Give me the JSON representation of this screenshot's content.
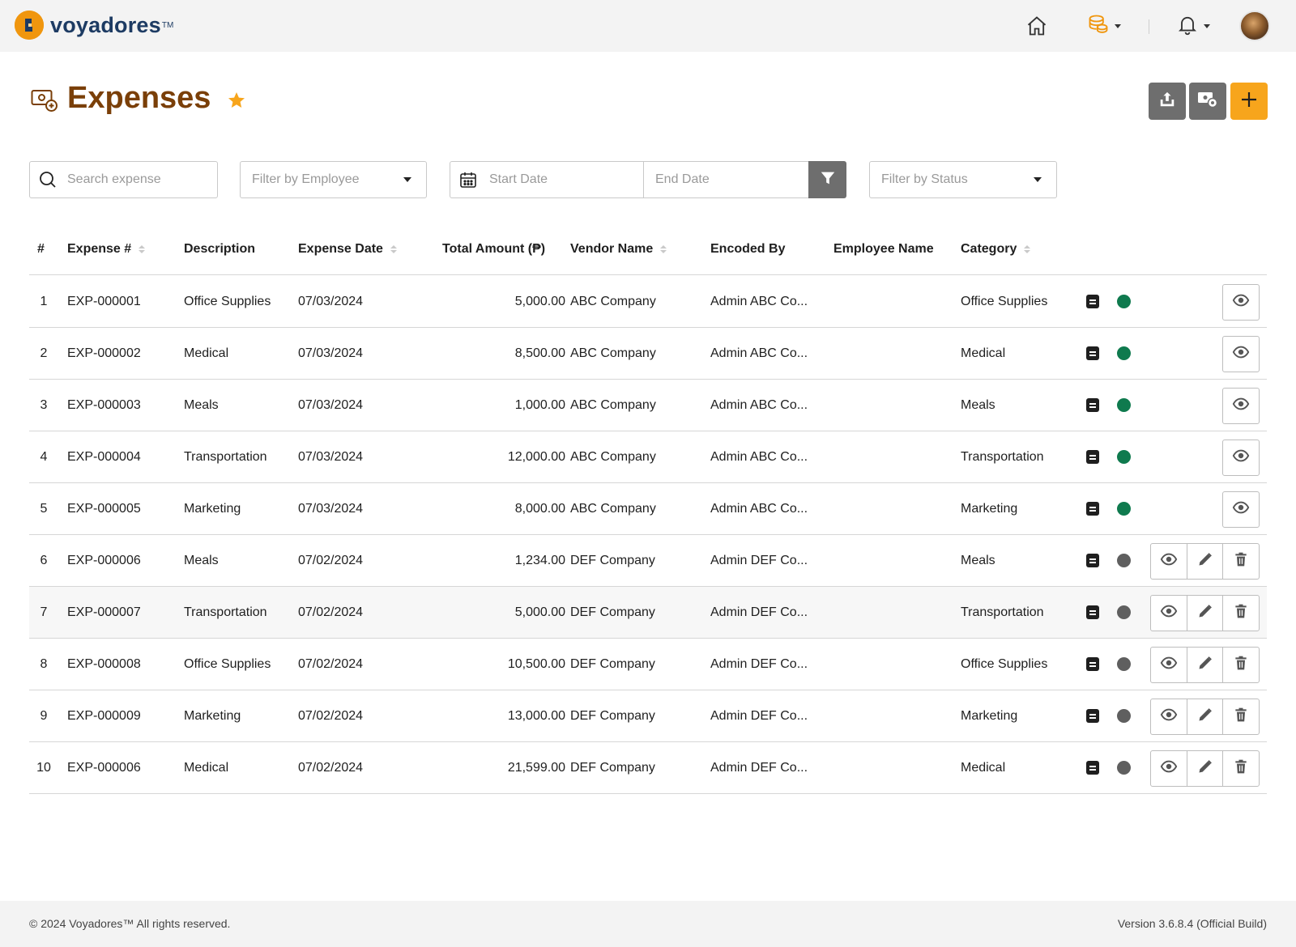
{
  "brand": {
    "name": "voyadores",
    "tm": "TM",
    "accent": "#f7a51c",
    "title_color": "#7a3f08"
  },
  "topbar": {
    "icons": [
      "home-icon",
      "coins-icon",
      "bell-icon"
    ],
    "avatar": "user-avatar"
  },
  "header": {
    "title": "Expenses",
    "icon": "money-icon",
    "favorite": "star-icon"
  },
  "toolbar": {
    "buttons": [
      "upload-icon",
      "expense-settings-icon",
      "plus-icon"
    ]
  },
  "filters": {
    "search_placeholder": "Search expense",
    "employee_placeholder": "Filter by Employee",
    "start_date_placeholder": "Start Date",
    "end_date_placeholder": "End Date",
    "status_placeholder": "Filter by Status"
  },
  "table": {
    "columns": {
      "num": "#",
      "expense_no": "Expense #",
      "description": "Description",
      "expense_date": "Expense Date",
      "total_amount": "Total Amount (₱)",
      "vendor": "Vendor Name",
      "encoded_by": "Encoded By",
      "employee": "Employee Name",
      "category": "Category"
    },
    "status_colors": {
      "approved": "#0f7a4e",
      "pending": "#5f5f5f"
    },
    "rows": [
      {
        "num": "1",
        "expense_no": "EXP-000001",
        "description": "Office Supplies",
        "date": "07/03/2024",
        "amount": "5,000.00",
        "vendor": "ABC Company",
        "encoded_by": "Admin ABC Co...",
        "employee": "",
        "category": "Office Supplies",
        "status": "approved"
      },
      {
        "num": "2",
        "expense_no": "EXP-000002",
        "description": "Medical",
        "date": "07/03/2024",
        "amount": "8,500.00",
        "vendor": "ABC Company",
        "encoded_by": "Admin ABC Co...",
        "employee": "",
        "category": "Medical",
        "status": "approved"
      },
      {
        "num": "3",
        "expense_no": "EXP-000003",
        "description": "Meals",
        "date": "07/03/2024",
        "amount": "1,000.00",
        "vendor": "ABC Company",
        "encoded_by": "Admin ABC Co...",
        "employee": "",
        "category": "Meals",
        "status": "approved"
      },
      {
        "num": "4",
        "expense_no": "EXP-000004",
        "description": "Transportation",
        "date": "07/03/2024",
        "amount": "12,000.00",
        "vendor": "ABC Company",
        "encoded_by": "Admin ABC Co...",
        "employee": "",
        "category": "Transportation",
        "status": "approved"
      },
      {
        "num": "5",
        "expense_no": "EXP-000005",
        "description": "Marketing",
        "date": "07/03/2024",
        "amount": "8,000.00",
        "vendor": "ABC Company",
        "encoded_by": "Admin ABC Co...",
        "employee": "",
        "category": "Marketing",
        "status": "approved"
      },
      {
        "num": "6",
        "expense_no": "EXP-000006",
        "description": "Meals",
        "date": "07/02/2024",
        "amount": "1,234.00",
        "vendor": "DEF Company",
        "encoded_by": "Admin DEF Co...",
        "employee": "",
        "category": "Meals",
        "status": "pending"
      },
      {
        "num": "7",
        "expense_no": "EXP-000007",
        "description": "Transportation",
        "date": "07/02/2024",
        "amount": "5,000.00",
        "vendor": "DEF Company",
        "encoded_by": "Admin DEF Co...",
        "employee": "",
        "category": "Transportation",
        "status": "pending"
      },
      {
        "num": "8",
        "expense_no": "EXP-000008",
        "description": "Office Supplies",
        "date": "07/02/2024",
        "amount": "10,500.00",
        "vendor": "DEF Company",
        "encoded_by": "Admin DEF Co...",
        "employee": "",
        "category": "Office Supplies",
        "status": "pending"
      },
      {
        "num": "9",
        "expense_no": "EXP-000009",
        "description": "Marketing",
        "date": "07/02/2024",
        "amount": "13,000.00",
        "vendor": "DEF Company",
        "encoded_by": "Admin DEF Co...",
        "employee": "",
        "category": "Marketing",
        "status": "pending"
      },
      {
        "num": "10",
        "expense_no": "EXP-000006",
        "description": "Medical",
        "date": "07/02/2024",
        "amount": "21,599.00",
        "vendor": "DEF Company",
        "encoded_by": "Admin DEF Co...",
        "employee": "",
        "category": "Medical",
        "status": "pending"
      }
    ]
  },
  "footer": {
    "copyright": "© 2024 Voyadores™ All rights reserved.",
    "version": "Version 3.6.8.4 (Official Build)"
  }
}
